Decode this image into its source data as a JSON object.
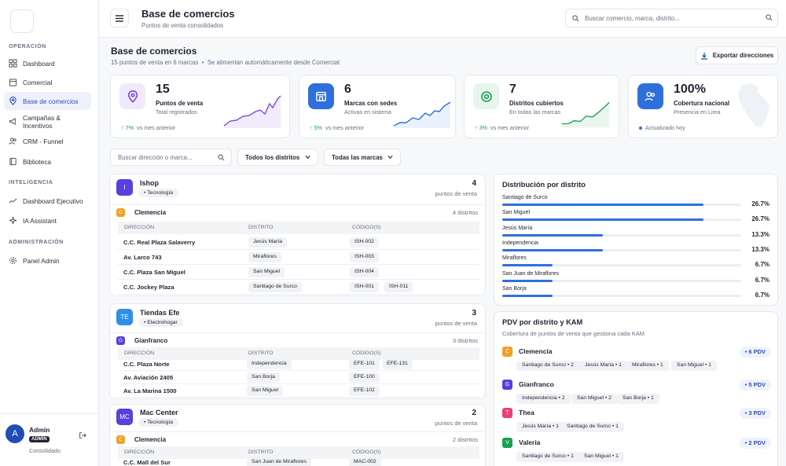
{
  "sidebar": {
    "sections": [
      "OPERACIÓN",
      "INTELIGENCIA",
      "ADMINISTRACIÓN"
    ],
    "items": [
      {
        "label": "Dashboard",
        "icon": "grid-icon"
      },
      {
        "label": "Comercial",
        "icon": "calendar-icon"
      },
      {
        "label": "Base de comercios",
        "icon": "map-pin-icon",
        "active": true
      },
      {
        "label": "Campañas & Incentivos",
        "icon": "megaphone-icon"
      },
      {
        "label": "CRM - Funnel",
        "icon": "users-icon"
      },
      {
        "label": "Biblioteca",
        "icon": "book-icon"
      },
      {
        "label": "Dashboard Ejecutivo",
        "icon": "trend-icon"
      },
      {
        "label": "IA Assistant",
        "icon": "sparkle-icon"
      },
      {
        "label": "Panel Admin",
        "icon": "gear-icon"
      }
    ],
    "user": {
      "initial": "A",
      "name": "Admin",
      "role": "ADMIN",
      "sub": "Consolidado"
    }
  },
  "header": {
    "title": "Base de comercios",
    "subtitle": "Puntos de venta consolidados",
    "search_placeholder": "Buscar comercio, marca, distrito..."
  },
  "page": {
    "title": "Base de comercios",
    "subtitle": "15 puntos de venta en 6 marcas",
    "note": "Se alimentan automáticamente desde Comercial",
    "export_label": "Exportar direcciones"
  },
  "kpis": [
    {
      "value": "15",
      "label": "Puntos de venta",
      "sub": "Total registrados",
      "delta": "7%",
      "delta_label": "vs mes anterior",
      "color": "#7d4ad6",
      "bg": "#f0e9fc",
      "icon": "map-pin-icon"
    },
    {
      "value": "6",
      "label": "Marcas con sedes",
      "sub": "Activas en sistema",
      "delta": "5%",
      "delta_label": "vs mes anterior",
      "color": "#ffffff",
      "bg": "#2f6fdc",
      "icon": "store-icon"
    },
    {
      "value": "7",
      "label": "Distritos cubiertos",
      "sub": "En todas las marcas",
      "delta": "3%",
      "delta_label": "vs mes anterior",
      "color": "#1a9e52",
      "bg": "#e6f6ec",
      "icon": "target-icon"
    },
    {
      "value": "100%",
      "label": "Cobertura nacional",
      "sub": "Presencia en Lima",
      "delta_label": "Actualizado hoy",
      "color": "#ffffff",
      "bg": "#2f6fdc",
      "icon": "users-icon"
    }
  ],
  "filters": {
    "search_placeholder": "Buscar dirección o marca...",
    "district": "Todos los distritos",
    "brand": "Todas las marcas"
  },
  "table_headers": [
    "DIRECCIÓN",
    "DISTRITO",
    "CÓDIGO(S)"
  ],
  "count_label": "puntos de venta",
  "brands": [
    {
      "initials": "I",
      "name": "Ishop",
      "tag": "Tecnología",
      "count": "4",
      "color": "#5a3fe0",
      "kam": {
        "initial": "C",
        "name": "Clemencia",
        "districts": "4 distritos",
        "color": "#f2a024"
      },
      "rows": [
        {
          "dir": "C.C. Real Plaza Salaverry",
          "dist": "Jesús María",
          "codes": [
            "ISH-002"
          ]
        },
        {
          "dir": "Av. Larco 743",
          "dist": "Miraflores",
          "codes": [
            "ISH-003"
          ]
        },
        {
          "dir": "C.C. Plaza San Miguel",
          "dist": "San Miguel",
          "codes": [
            "ISH-004"
          ]
        },
        {
          "dir": "C.C. Jockey Plaza",
          "dist": "Santiago de Surco",
          "codes": [
            "ISH-001",
            "ISH-011"
          ]
        }
      ]
    },
    {
      "initials": "TE",
      "name": "Tiendas Efe",
      "tag": "Electrohogar",
      "count": "3",
      "color": "#2f8fe8",
      "kam": {
        "initial": "G",
        "name": "Gianfranco",
        "districts": "3 distritos",
        "color": "#5a3fe0"
      },
      "rows": [
        {
          "dir": "C.C. Plaza Norte",
          "dist": "Independencia",
          "codes": [
            "EFE-101",
            "EFE-131"
          ]
        },
        {
          "dir": "Av. Aviación 2405",
          "dist": "San Borja",
          "codes": [
            "EFE-100"
          ]
        },
        {
          "dir": "Av. La Marina 1500",
          "dist": "San Miguel",
          "codes": [
            "EFE-102"
          ]
        }
      ]
    },
    {
      "initials": "MC",
      "name": "Mac Center",
      "tag": "Tecnología",
      "count": "2",
      "color": "#5a3fe0",
      "kam": {
        "initial": "C",
        "name": "Clemencia",
        "districts": "2 distritos",
        "color": "#f2a024"
      },
      "rows": [
        {
          "dir": "C.C. Mall del Sur",
          "dist": "San Juan de Miraflores",
          "codes": [
            "MAC-002"
          ]
        }
      ]
    }
  ],
  "distribution": {
    "title": "Distribución por distrito",
    "items": [
      {
        "label": "Santiago de Surco",
        "pct": "26.7%",
        "value": 26.7
      },
      {
        "label": "San Miguel",
        "pct": "26.7%",
        "value": 26.7
      },
      {
        "label": "Jesús María",
        "pct": "13.3%",
        "value": 13.3
      },
      {
        "label": "Independencia",
        "pct": "13.3%",
        "value": 13.3
      },
      {
        "label": "Miraflores",
        "pct": "6.7%",
        "value": 6.7
      },
      {
        "label": "San Juan de Miraflores",
        "pct": "6.7%",
        "value": 6.7
      },
      {
        "label": "San Borja",
        "pct": "6.7%",
        "value": 6.7
      }
    ]
  },
  "pdv": {
    "title": "PDV por distrito y KAM",
    "subtitle": "Cobertura de puntos de venta que gestiona cada KAM",
    "kams": [
      {
        "initial": "C",
        "name": "Clemencia",
        "total": "• 6 PDV",
        "color": "#f2a024",
        "chips": [
          "Santiago de Surco • 2",
          "Jesús María • 1",
          "Miraflores • 1",
          "San Miguel • 1"
        ]
      },
      {
        "initial": "G",
        "name": "Gianfranco",
        "total": "• 5 PDV",
        "color": "#5a3fe0",
        "chips": [
          "Independencia • 2",
          "San Miguel • 2",
          "San Borja • 1"
        ]
      },
      {
        "initial": "T",
        "name": "Thea",
        "total": "• 3 PDV",
        "color": "#e8407d",
        "chips": [
          "Jesús María • 1",
          "Santiago de Surco • 1"
        ]
      },
      {
        "initial": "V",
        "name": "Valeria",
        "total": "• 2 PDV",
        "color": "#1a9e52",
        "chips": [
          "Santiago de Surco • 1",
          "San Miguel • 1"
        ]
      }
    ]
  }
}
